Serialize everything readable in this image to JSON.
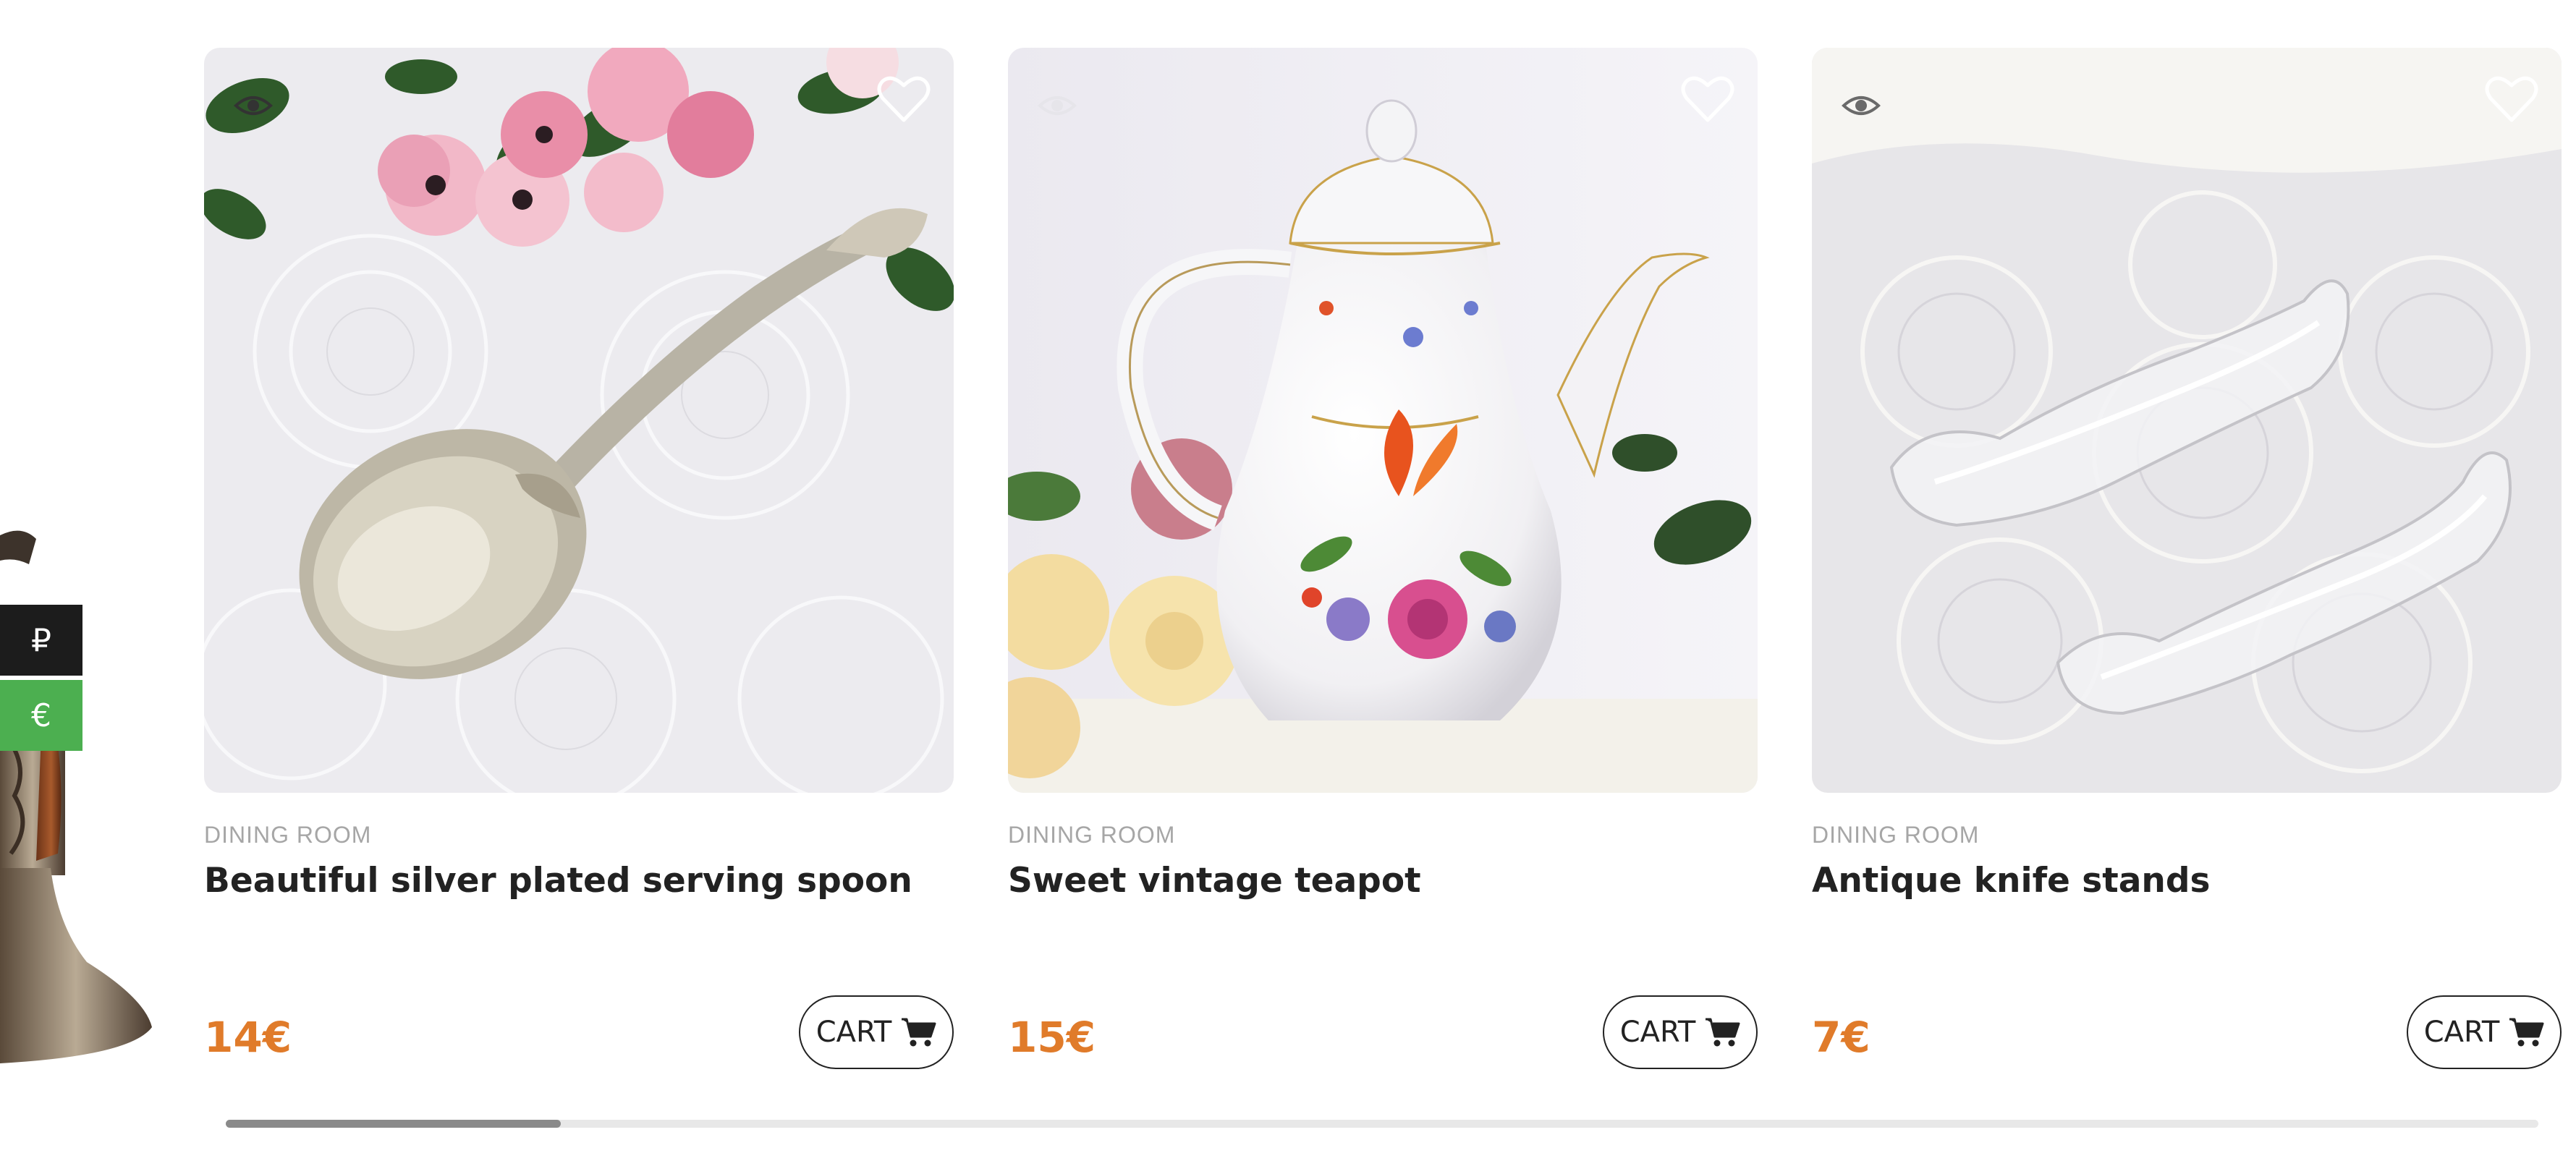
{
  "currency_switcher": {
    "options": [
      {
        "symbol": "₽",
        "code": "ruble"
      },
      {
        "symbol": "€",
        "code": "euro"
      }
    ],
    "colors": {
      "ruble_bg": "#1c1c1c",
      "euro_bg": "#4caf50"
    }
  },
  "products": [
    {
      "category": "DINING ROOM",
      "title": "Beautiful silver plated serving spoon",
      "price": "14€",
      "cart_label": "CART",
      "image": "silver serving spoon on lace with pink flowers"
    },
    {
      "category": "DINING ROOM",
      "title": "Sweet vintage teapot",
      "price": "15€",
      "cart_label": "CART",
      "image": "white floral porcelain teapot"
    },
    {
      "category": "DINING ROOM",
      "title": "Antique knife stands",
      "price": "7€",
      "cart_label": "CART",
      "image": "two glass knife rests on lace"
    }
  ],
  "icons": {
    "quick_view": "eye-icon",
    "wishlist": "heart-icon",
    "cart": "cart-icon"
  },
  "colors": {
    "price": "#e07b2a",
    "category": "#a6a6a6",
    "title": "#222222"
  },
  "carousel": {
    "scroll_position_fraction": 0.0,
    "visible_fraction": 0.145
  }
}
